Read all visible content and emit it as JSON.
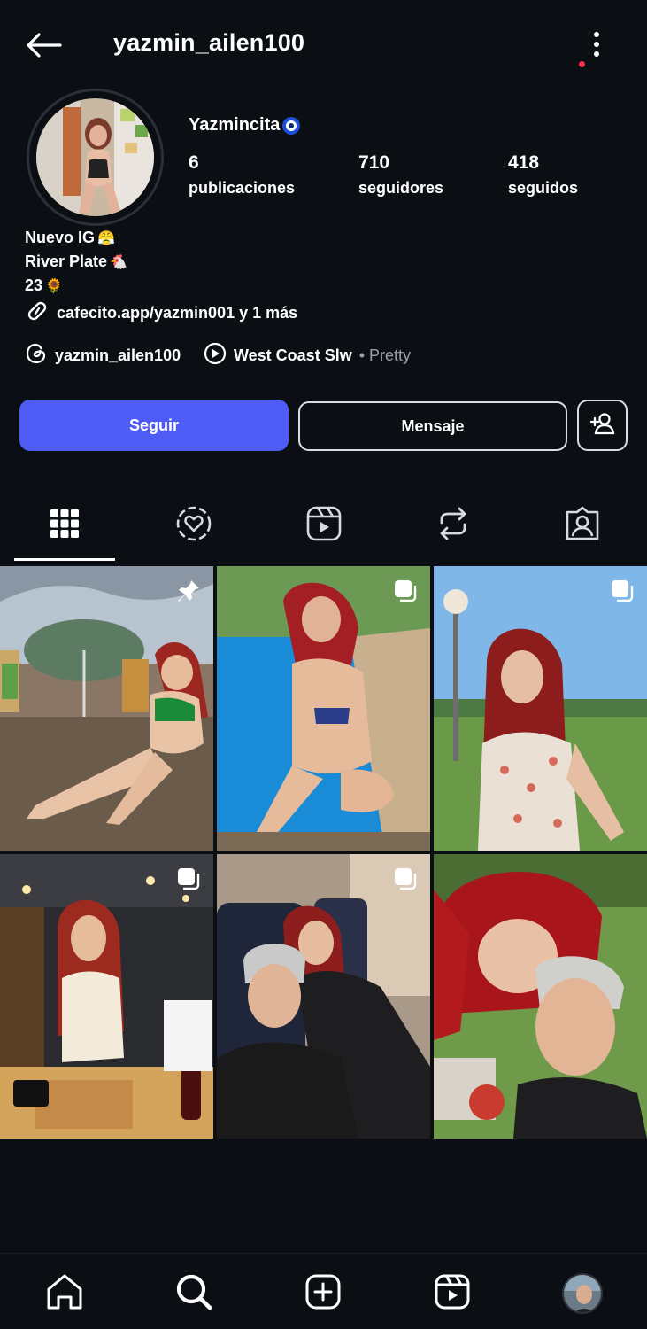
{
  "header": {
    "username": "yazmin_ailen100"
  },
  "profile": {
    "display_name": "Yazmincita",
    "stats": [
      {
        "value": "6",
        "label": "publicaciones"
      },
      {
        "value": "710",
        "label": "seguidores"
      },
      {
        "value": "418",
        "label": "seguidos"
      }
    ],
    "bio": [
      {
        "text": "Nuevo IG",
        "emoji": "😤"
      },
      {
        "text": "River Plate",
        "emoji": "🐔"
      },
      {
        "text": "23",
        "emoji": "🌻"
      }
    ],
    "link_text": "cafecito.app/yazmin001 y 1 más",
    "threads_handle": "yazmin_ailen100",
    "music_title": "West Coast Slw",
    "music_artist": " • Pretty"
  },
  "actions": {
    "follow_label": "Seguir",
    "message_label": "Mensaje"
  },
  "tabs": [
    {
      "name": "posts",
      "icon": "grid-icon",
      "active": true
    },
    {
      "name": "highlights",
      "icon": "heart-circle-icon",
      "active": false
    },
    {
      "name": "reels",
      "icon": "reels-icon",
      "active": false
    },
    {
      "name": "reposts",
      "icon": "repost-icon",
      "active": false
    },
    {
      "name": "tagged",
      "icon": "tagged-icon",
      "active": false
    }
  ],
  "posts": [
    {
      "badge": "pin-icon"
    },
    {
      "badge": "carousel-icon"
    },
    {
      "badge": "carousel-icon"
    },
    {
      "badge": "carousel-icon"
    },
    {
      "badge": "carousel-icon"
    },
    {
      "badge": ""
    }
  ],
  "bottom_nav": [
    {
      "icon": "home-icon"
    },
    {
      "icon": "search-icon"
    },
    {
      "icon": "create-icon"
    },
    {
      "icon": "reels-icon"
    },
    {
      "icon": "profile-avatar"
    }
  ],
  "colors": {
    "background": "#0b0f14",
    "follow_button": "#4f5bf5",
    "notification_dot": "#ff2d4a"
  }
}
